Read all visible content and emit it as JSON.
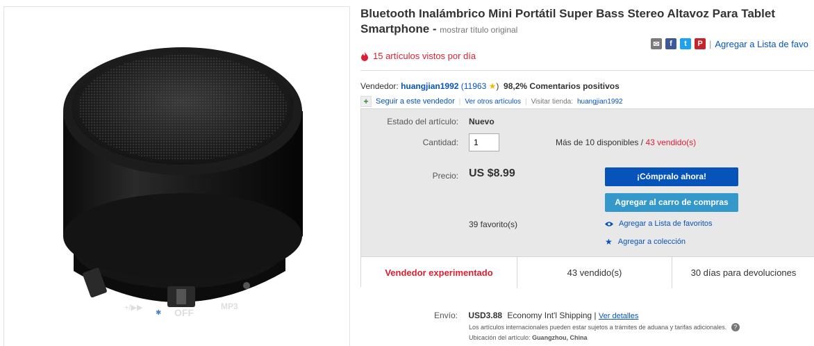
{
  "title": {
    "main_line1": "Bluetooth Inalámbrico Mini Portátil Super Bass Stereo Altavoz Para Tablet",
    "main_line2": "Smartphone",
    "separator": " - ",
    "show_original": "mostrar título original"
  },
  "share": {
    "watchlist_link": "Agregar a Lista de favo"
  },
  "views": {
    "text": "15 artículos vistos por día"
  },
  "seller": {
    "label": "Vendedor:",
    "name": "huangjian1992",
    "feedback_count": "(11963",
    "feedback_close": ")",
    "positive": "98,2%",
    "positive_label": "Comentarios positivos",
    "follow": "Seguir a este vendedor",
    "other_items": "Ver otros artículos",
    "store_label": "Visitar tienda:",
    "store_name": "huangjian1992"
  },
  "item": {
    "condition_label": "Estado del artículo:",
    "condition": "Nuevo",
    "quantity_label": "Cantidad:",
    "quantity_value": "1",
    "available": "Más de 10 disponibles",
    "slash": " / ",
    "sold_link": "43 vendido(s)",
    "price_label": "Precio:",
    "price": "US $8.99",
    "buy_now": "¡Cómpralo ahora!",
    "add_cart": "Agregar al carro de compras",
    "favorites": "39 favorito(s)",
    "add_watch": "Agregar a Lista de favoritos",
    "add_collection": "Agregar a colección"
  },
  "stats": {
    "experienced": "Vendedor experimentado",
    "sold": "43 vendido(s)",
    "returns": "30 días para devoluciones"
  },
  "shipping": {
    "label": "Envío:",
    "price": "USD3.88",
    "service": "Economy Int'l Shipping |",
    "details": "Ver detalles",
    "note": "Los artículos internacionales pueden estar sujetos a trámites de aduana y tarifas adicionales.",
    "location_label": "Ubicación del artículo:",
    "location": "Guangzhou, China"
  },
  "colors": {
    "link": "#0654ba",
    "red": "#dd1e31",
    "buy_button": "#0654ba",
    "cart_button": "#3498ca"
  },
  "icons": [
    "email-icon",
    "facebook-icon",
    "twitter-icon",
    "pinterest-icon",
    "flame-icon",
    "star-icon",
    "plus-icon",
    "eye-icon",
    "blue-star-icon",
    "help-icon"
  ]
}
